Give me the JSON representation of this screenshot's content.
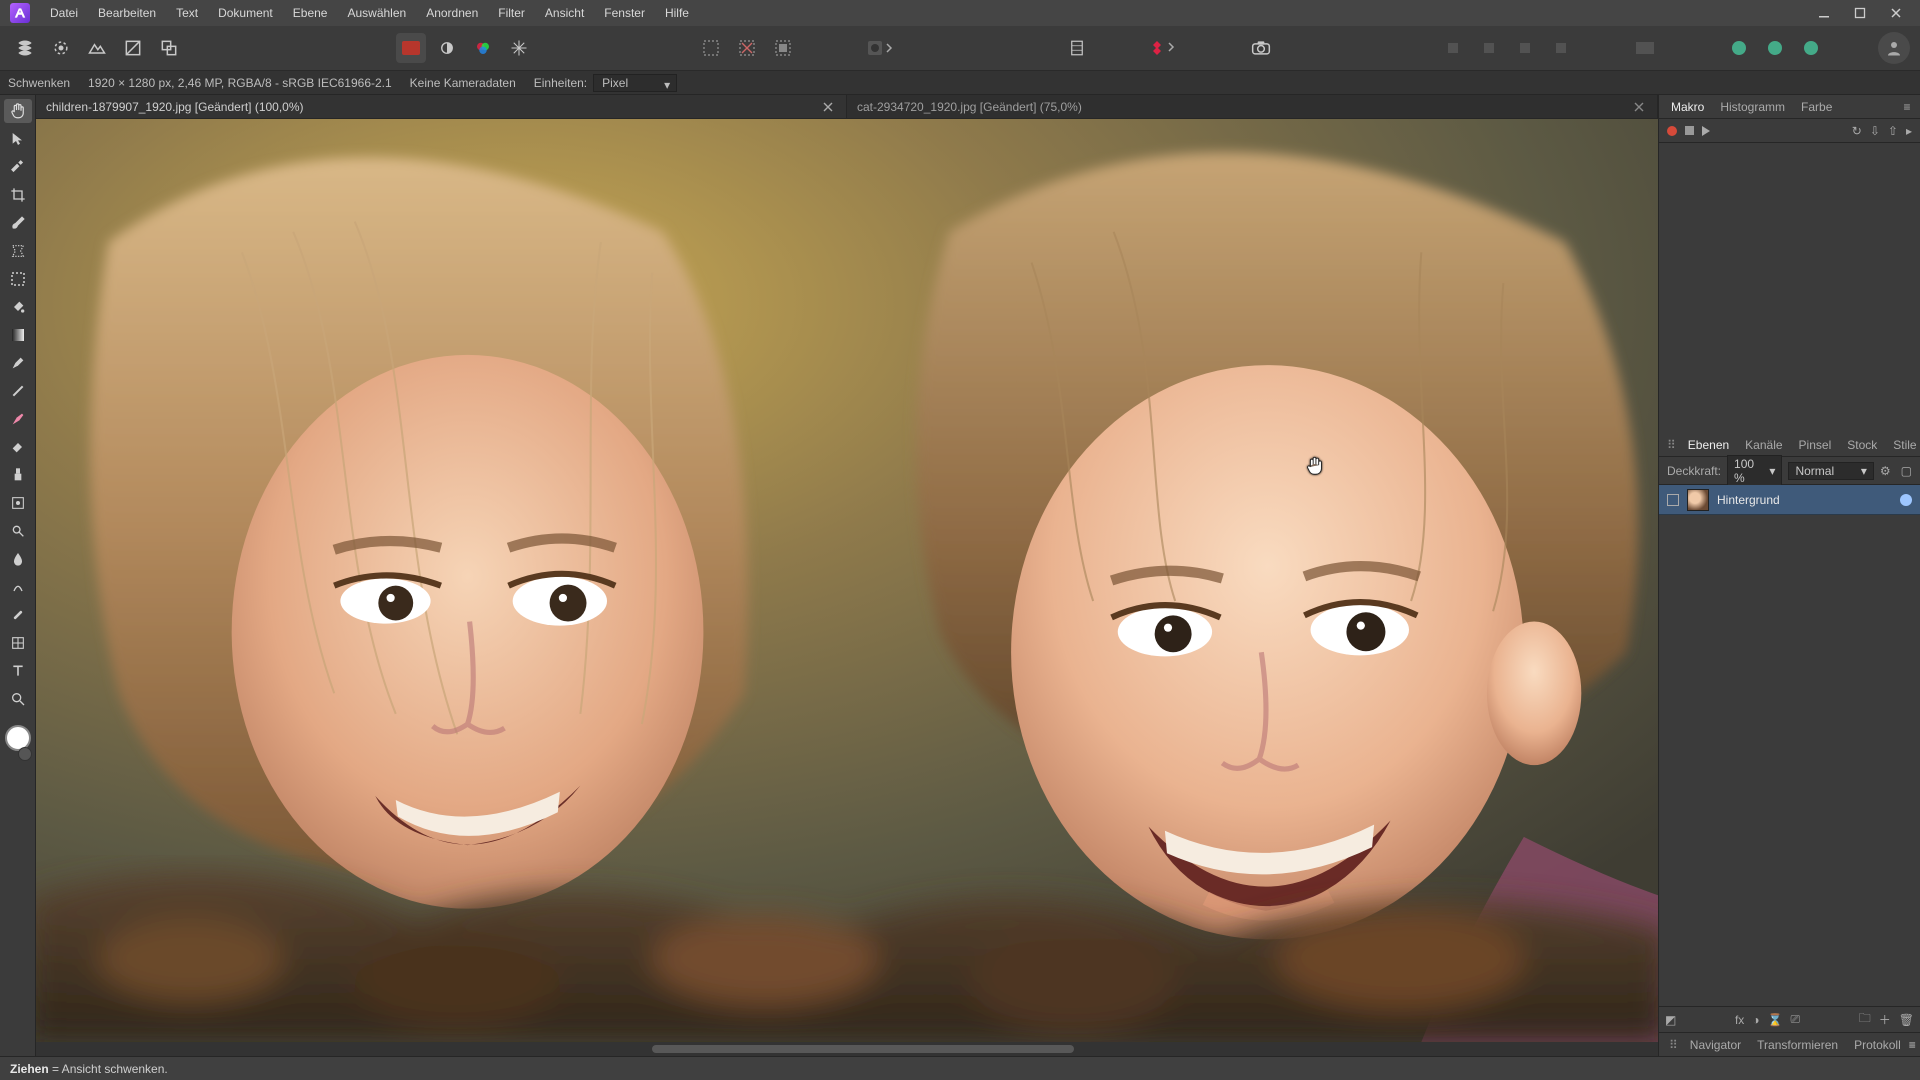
{
  "menu": [
    "Datei",
    "Bearbeiten",
    "Text",
    "Dokument",
    "Ebene",
    "Auswählen",
    "Anordnen",
    "Filter",
    "Ansicht",
    "Fenster",
    "Hilfe"
  ],
  "context": {
    "tool": "Schwenken",
    "dims": "1920 × 1280 px, 2,46 MP, RGBA/8 - sRGB IEC61966-2.1",
    "camera": "Keine Kameradaten",
    "units_label": "Einheiten:",
    "units_value": "Pixel"
  },
  "tabs": [
    {
      "title": "children-1879907_1920.jpg [Geändert] (100,0%)",
      "active": true
    },
    {
      "title": "cat-2934720_1920.jpg [Geändert] (75,0%)",
      "active": false
    }
  ],
  "rightTop": {
    "tabs": [
      "Makro",
      "Histogramm",
      "Farbe"
    ],
    "active": 0
  },
  "layersPanel": {
    "tabs": [
      "Ebenen",
      "Kanäle",
      "Pinsel",
      "Stock",
      "Stile"
    ],
    "active": 0,
    "opacity_label": "Deckkraft:",
    "opacity_value": "100 %",
    "blend_mode": "Normal",
    "layer_name": "Hintergrund"
  },
  "bottomPanel": {
    "tabs": [
      "Navigator",
      "Transformieren",
      "Protokoll"
    ]
  },
  "status": {
    "bold": "Ziehen",
    "rest": " = Ansicht schwenken."
  }
}
